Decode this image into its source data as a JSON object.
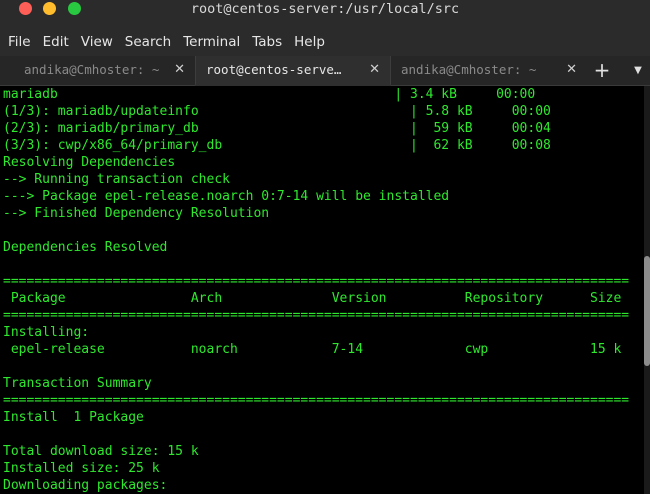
{
  "window": {
    "title": "root@centos-server:/usr/local/src"
  },
  "menu": [
    "File",
    "Edit",
    "View",
    "Search",
    "Terminal",
    "Tabs",
    "Help"
  ],
  "tabs": [
    {
      "label": "andika@Cmhoster: ~",
      "active": false
    },
    {
      "label": "root@centos-serve…",
      "active": true
    },
    {
      "label": "andika@Cmhoster: ~",
      "active": false
    }
  ],
  "tab_controls": {
    "close_glyph": "✕",
    "new_tab_glyph": "+",
    "menu_glyph": "▼"
  },
  "terminal": {
    "text_color": "#2ee82e",
    "lines": [
      "mariadb                                           | 3.4 kB     00:00",
      "(1/3): mariadb/updateinfo                           | 5.8 kB     00:00",
      "(2/3): mariadb/primary_db                           |  59 kB     00:04",
      "(3/3): cwp/x86_64/primary_db                        |  62 kB     00:08",
      "Resolving Dependencies",
      "--> Running transaction check",
      "---> Package epel-release.noarch 0:7-14 will be installed",
      "--> Finished Dependency Resolution",
      "",
      "Dependencies Resolved",
      "",
      "================================================================================",
      " Package                Arch              Version          Repository      Size",
      "================================================================================",
      "Installing:",
      " epel-release           noarch            7-14             cwp             15 k",
      "",
      "Transaction Summary",
      "================================================================================",
      "Install  1 Package",
      "",
      "Total download size: 15 k",
      "Installed size: 25 k",
      "Downloading packages:"
    ]
  }
}
